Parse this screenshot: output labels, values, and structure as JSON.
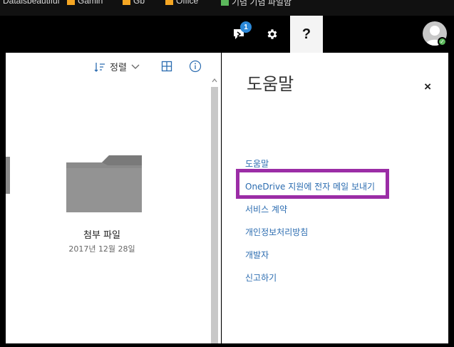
{
  "bookmarks": [
    {
      "label": "Dataisbeautiful",
      "color": "#ffffff"
    },
    {
      "label": "Gamin",
      "color": "#f5a623"
    },
    {
      "label": "Gb",
      "color": "#f5a623"
    },
    {
      "label": "Office",
      "color": "#f5a623"
    },
    {
      "label": "기념 기념 파일함",
      "color": "#5cb85c"
    }
  ],
  "topbar": {
    "notification_count": "1",
    "help_glyph": "?",
    "icons": [
      "feedback-icon",
      "gear-icon",
      "help-icon",
      "avatar-icon"
    ]
  },
  "toolbar": {
    "sort_label": "정렬"
  },
  "files": [
    {
      "name": "첨부 파일",
      "date": "2017년 12월 28일"
    }
  ],
  "help": {
    "title": "도움말",
    "close_glyph": "×",
    "links": [
      "도움말",
      "OneDrive 지원에 전자 메일 보내기",
      "서비스 계약",
      "개인정보처리방침",
      "개발자",
      "신고하기"
    ]
  },
  "colors": {
    "accent_link": "#2b6cb0",
    "highlight": "#9b2da6",
    "badge": "#2b88d8",
    "status_ok": "#5cb85c"
  }
}
